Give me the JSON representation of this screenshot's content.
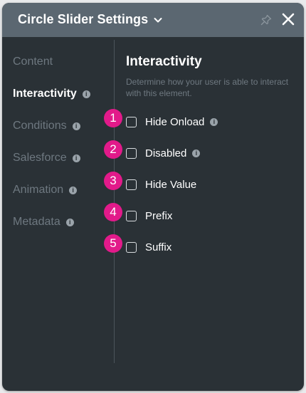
{
  "header": {
    "title": "Circle Slider Settings"
  },
  "sidebar": {
    "items": [
      {
        "label": "Content",
        "info": false,
        "active": false
      },
      {
        "label": "Interactivity",
        "info": true,
        "active": true
      },
      {
        "label": "Conditions",
        "info": true,
        "active": false
      },
      {
        "label": "Salesforce",
        "info": true,
        "active": false
      },
      {
        "label": "Animation",
        "info": true,
        "active": false
      },
      {
        "label": "Metadata",
        "info": true,
        "active": false
      }
    ]
  },
  "main": {
    "title": "Interactivity",
    "description": "Determine how your user is able to interact with this element.",
    "options": [
      {
        "label": "Hide Onload",
        "checked": false,
        "info": true,
        "badge": "1"
      },
      {
        "label": "Disabled",
        "checked": false,
        "info": true,
        "badge": "2"
      },
      {
        "label": "Hide Value",
        "checked": false,
        "info": false,
        "badge": "3"
      },
      {
        "label": "Prefix",
        "checked": false,
        "info": false,
        "badge": "4"
      },
      {
        "label": "Suffix",
        "checked": false,
        "info": false,
        "badge": "5"
      }
    ]
  },
  "info_glyph": "i",
  "colors": {
    "header_bg": "#5b6771",
    "panel_bg": "#2a3136",
    "badge": "#e21a8a",
    "muted_text": "#6e7880"
  }
}
